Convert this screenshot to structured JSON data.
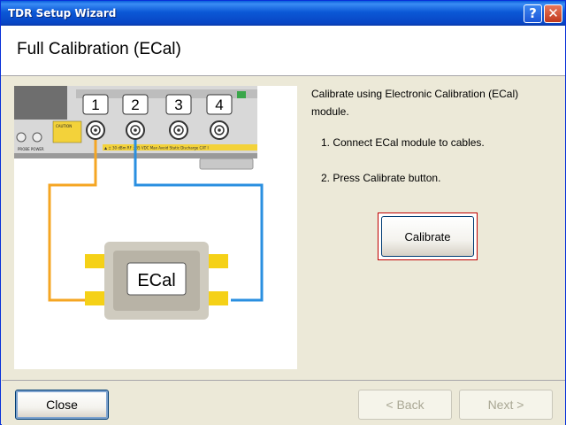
{
  "window": {
    "title": "TDR Setup Wizard",
    "help_label": "?",
    "close_label": "✕"
  },
  "header": {
    "title": "Full Calibration (ECal)"
  },
  "diagram": {
    "ports": [
      "1",
      "2",
      "3",
      "4"
    ],
    "module_label": "ECal",
    "panel_label": "PROBE POWER",
    "caution_label": "CAUTION",
    "warning_strip": "▲ ± 30 dBm RF ±35 VDC Max   Avoid Static Discharge CAT I",
    "cable_colors": {
      "port1": "#f5a623",
      "port2": "#2a8fe0"
    }
  },
  "instructions": {
    "main": "Calibrate using Electronic Calibration (ECal) module.",
    "step1": "1. Connect ECal module to cables.",
    "step2": "2. Press Calibrate button."
  },
  "calibrate_button": "Calibrate",
  "footer": {
    "close": "Close",
    "back": "< Back",
    "next": "Next >"
  }
}
